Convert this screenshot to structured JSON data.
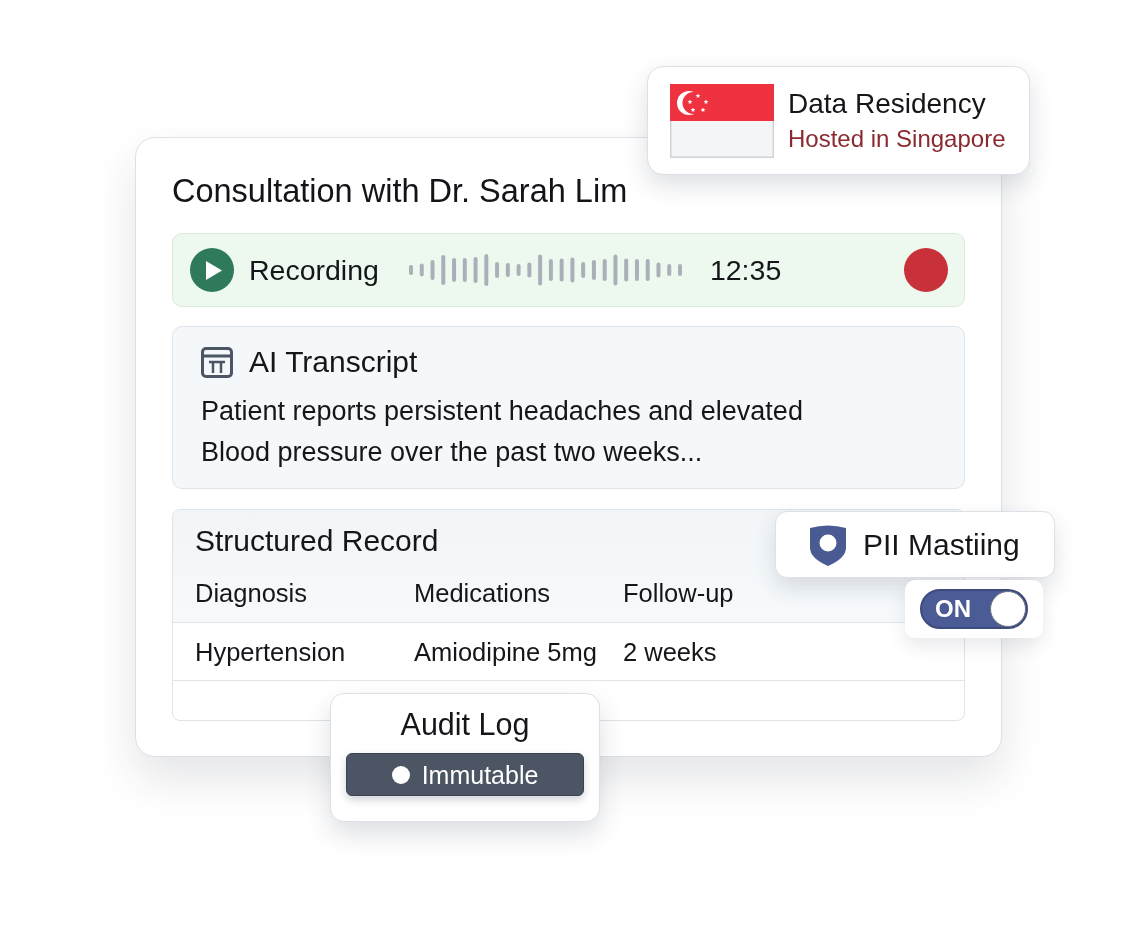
{
  "data_residency": {
    "title": "Data Residency",
    "location": "Hosted in Singapore"
  },
  "consultation": {
    "title": "Consultation with Dr. Sarah Lim"
  },
  "recording": {
    "label": "Recording",
    "time": "12:35"
  },
  "transcript": {
    "title": "AI Transcript",
    "lines": [
      "Patient reports persistent headaches and elevated",
      "Blood pressure over the past two weeks..."
    ]
  },
  "structured_record": {
    "title": "Structured Record",
    "columns": [
      "Diagnosis",
      "Medications",
      "Follow-up"
    ],
    "rows": [
      [
        "Hypertension",
        "Amiodipine 5mg",
        "2 weeks"
      ]
    ]
  },
  "pii_masking": {
    "label": "PII Mastiing",
    "toggle": {
      "label": "ON",
      "on": true
    }
  },
  "audit_log": {
    "title": "Audit Log",
    "badge": "Immutable"
  }
}
